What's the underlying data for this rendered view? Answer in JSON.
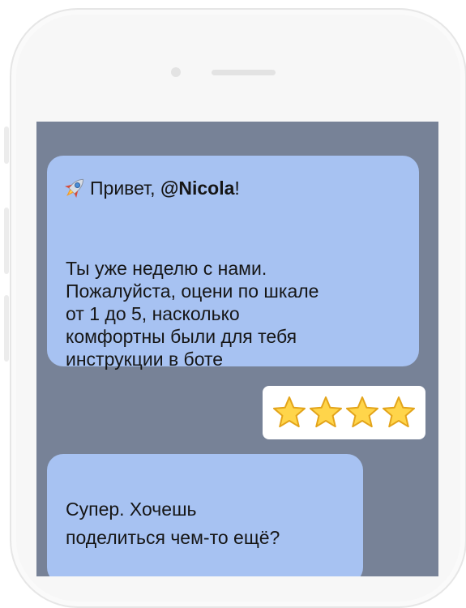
{
  "chat": {
    "message1": {
      "greeting_prefix": "Привет, ",
      "mention": "@Nicola",
      "greeting_suffix": "!",
      "lines": [
        "Ты уже неделю с нами.",
        "Пожалуйста, оцени по шкале",
        "от 1 до 5, насколько",
        "комфортны были для тебя",
        "инструкции в боте"
      ],
      "icon": "rocket-icon"
    },
    "rating_reply": {
      "stars": 4,
      "icon": "star-icon"
    },
    "message2": {
      "lines": [
        "Супер. Хочешь",
        "поделиться чем-то ещё?"
      ]
    }
  },
  "colors": {
    "screen_background": "#778297",
    "bot_bubble": "#a7c2f2",
    "user_bubble": "#ffffff",
    "star_fill": "#ffd54a",
    "star_stroke": "#e3a41a"
  }
}
